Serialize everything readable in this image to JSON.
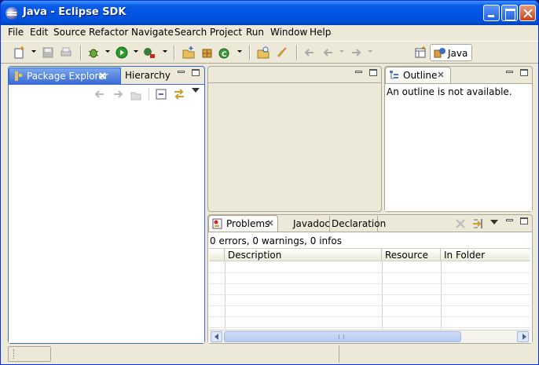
{
  "window": {
    "title": "Java - Eclipse SDK"
  },
  "menu": [
    "File",
    "Edit",
    "Source",
    "Refactor",
    "Navigate",
    "Search",
    "Project",
    "Run",
    "Window",
    "Help"
  ],
  "perspective": {
    "label": "Java"
  },
  "left_panel": {
    "tabs": [
      "Package Explorer",
      "Hierarchy"
    ]
  },
  "outline": {
    "tab": "Outline",
    "message": "An outline is not available."
  },
  "bottom_panel": {
    "tabs": [
      "Problems",
      "Javadoc",
      "Declaration"
    ],
    "summary": "0 errors, 0 warnings, 0 infos",
    "columns": [
      "Description",
      "Resource",
      "In Folder"
    ]
  },
  "colors": {
    "title_blue": "#0053e1",
    "active_tab": "#3a6ad5"
  },
  "icons": [
    "eclipse-app-icon",
    "new-wizard-icon",
    "save-icon",
    "print-icon",
    "debug-icon",
    "run-icon",
    "external-tools-icon",
    "new-java-project-icon",
    "new-package-icon",
    "new-class-icon",
    "open-type-icon",
    "search-icon",
    "back-icon",
    "forward-icon",
    "minimize-icon",
    "maximize-icon",
    "close-icon",
    "collapse-all-icon",
    "link-with-editor-icon",
    "view-menu-icon",
    "delete-icon",
    "filter-icon"
  ]
}
